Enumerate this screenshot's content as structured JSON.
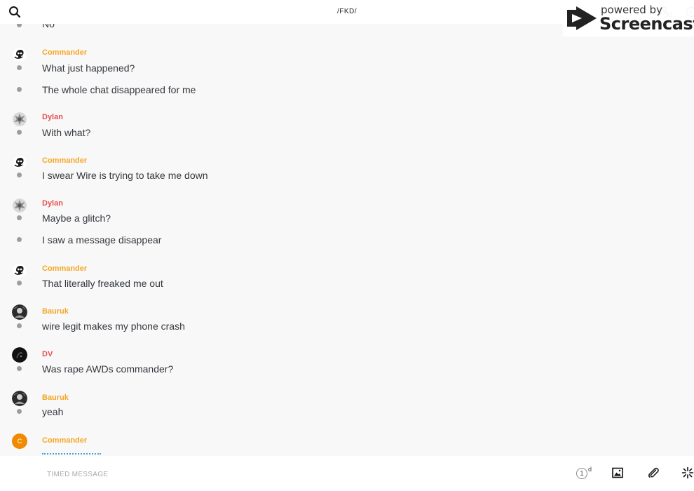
{
  "header": {
    "conversation_title": "/FKD/"
  },
  "watermark": {
    "powered_by": "powered by",
    "brand": "Screencastify"
  },
  "messages": [
    {
      "type": "text",
      "text": "No"
    },
    {
      "type": "sender",
      "name": "Commander",
      "color": "#f5a623",
      "avatar": "commander-skull"
    },
    {
      "type": "text",
      "text": "What just happened?"
    },
    {
      "type": "text",
      "text": "The whole chat disappeared for me"
    },
    {
      "type": "sender",
      "name": "Dylan",
      "color": "#e8504f",
      "avatar": "dylan-pattern"
    },
    {
      "type": "text",
      "text": "With what?"
    },
    {
      "type": "sender",
      "name": "Commander",
      "color": "#f5a623",
      "avatar": "commander-skull"
    },
    {
      "type": "text",
      "text": "I swear Wire is trying to take me down"
    },
    {
      "type": "sender",
      "name": "Dylan",
      "color": "#e8504f",
      "avatar": "dylan-pattern"
    },
    {
      "type": "text",
      "text": "Maybe a glitch?"
    },
    {
      "type": "text",
      "text": "I saw a message disappear"
    },
    {
      "type": "sender",
      "name": "Commander",
      "color": "#f5a623",
      "avatar": "commander-skull"
    },
    {
      "type": "text",
      "text": "That literally freaked me out"
    },
    {
      "type": "sender",
      "name": "Bauruk",
      "color": "#f5a623",
      "avatar": "bauruk-photo"
    },
    {
      "type": "text",
      "text": "wire legit makes my phone crash"
    },
    {
      "type": "sender",
      "name": "DV",
      "color": "#e8504f",
      "avatar": "dv-dark"
    },
    {
      "type": "text",
      "text": "Was rape AWDs commander?"
    },
    {
      "type": "sender",
      "name": "Bauruk",
      "color": "#f5a623",
      "avatar": "bauruk-photo"
    },
    {
      "type": "text",
      "text": "yeah"
    },
    {
      "type": "sender",
      "name": "Commander",
      "color": "#f5a623",
      "avatar": "initial-c",
      "initial": "C"
    }
  ],
  "composer": {
    "placeholder": "TIMED MESSAGE",
    "timer_value": "1",
    "timer_unit": "d"
  },
  "colors": {
    "accent_orange": "#f5a623",
    "accent_red": "#e8504f",
    "avatar_orange": "#f08a00",
    "link_blue": "#4aa0d5"
  }
}
